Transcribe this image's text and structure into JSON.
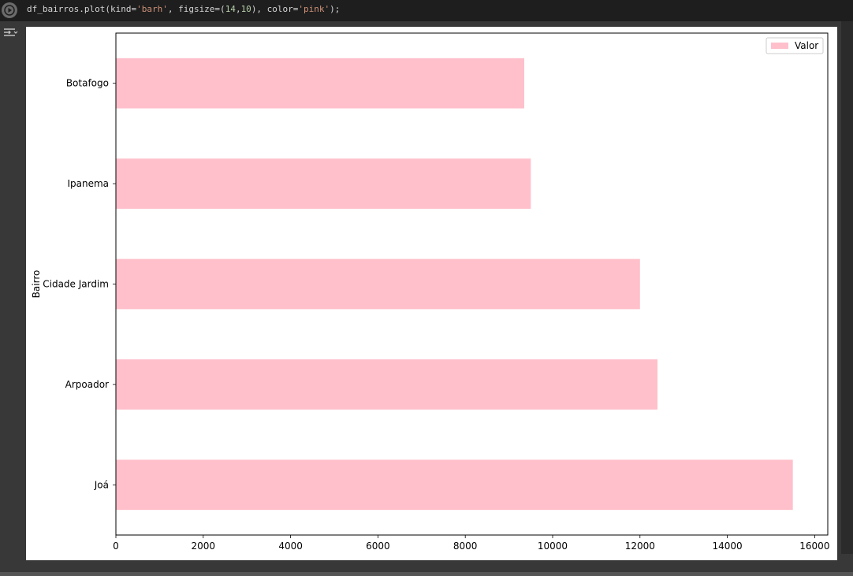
{
  "cell": {
    "code_parts": [
      {
        "text": "df_bairros.plot(kind=",
        "cls": ""
      },
      {
        "text": "'barh'",
        "cls": "tok-str"
      },
      {
        "text": ", figsize=(",
        "cls": ""
      },
      {
        "text": "14",
        "cls": "tok-num"
      },
      {
        "text": ",",
        "cls": ""
      },
      {
        "text": "10",
        "cls": "tok-num"
      },
      {
        "text": "), color=",
        "cls": ""
      },
      {
        "text": "'pink'",
        "cls": "tok-str"
      },
      {
        "text": ");",
        "cls": ""
      }
    ],
    "run_icon": "play-circle-icon",
    "output_icon": "output-toggle-icon"
  },
  "chart_data": {
    "type": "bar",
    "orientation": "horizontal",
    "categories": [
      "Joá",
      "Arpoador",
      "Cidade Jardim",
      "Ipanema",
      "Botafogo"
    ],
    "series": [
      {
        "name": "Valor",
        "values": [
          15500,
          12400,
          12000,
          9500,
          9350
        ],
        "color": "#ffc0cb"
      }
    ],
    "xlabel": "",
    "ylabel": "Bairro",
    "xlim": [
      0,
      16300
    ],
    "xticks": [
      0,
      2000,
      4000,
      6000,
      8000,
      10000,
      12000,
      14000,
      16000
    ],
    "grid": false,
    "legend_position": "top-right"
  }
}
